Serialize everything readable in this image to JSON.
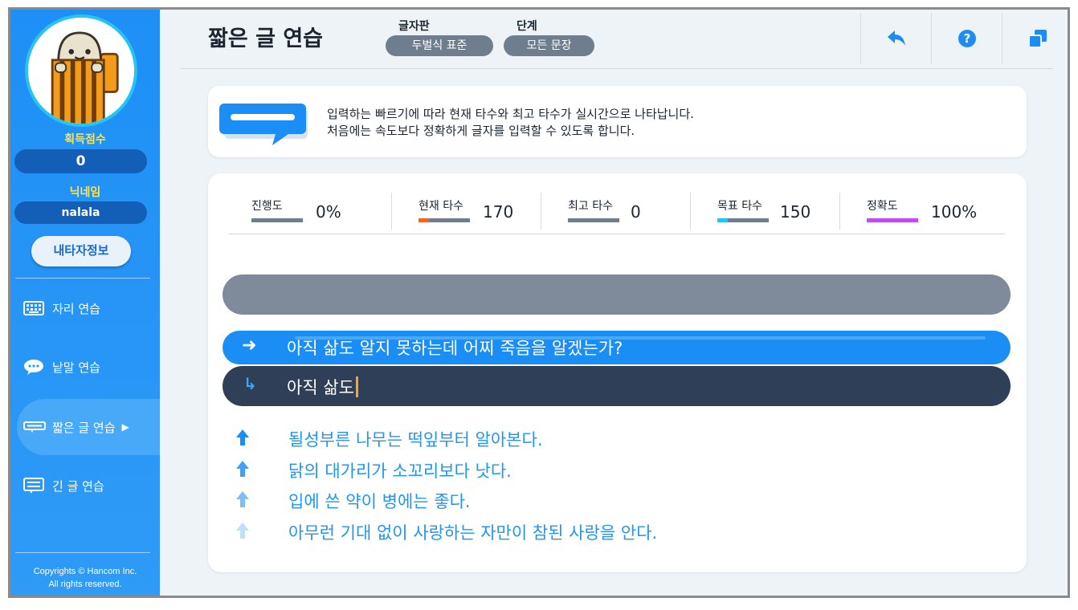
{
  "sidebar": {
    "score_label": "획득점수",
    "score_value": "0",
    "nickname_label": "닉네임",
    "nickname_value": "nalala",
    "my_info_button": "내타자정보",
    "menu": [
      {
        "label": "자리 연습",
        "icon": "keyboard-icon",
        "active": false
      },
      {
        "label": "낱말 연습",
        "icon": "speech-bubble-icon",
        "active": false
      },
      {
        "label": "짧은 글 연습",
        "icon": "short-text-icon",
        "active": true
      },
      {
        "label": "긴 글 연습",
        "icon": "long-text-icon",
        "active": false
      }
    ],
    "copyright_line1": "Copyrights © Hancom Inc.",
    "copyright_line2": "All rights reserved."
  },
  "header": {
    "title": "짧은 글 연습",
    "keyboard_label": "글자판",
    "keyboard_value": "두벌식 표준",
    "level_label": "단계",
    "level_value": "모든 문장",
    "buttons": [
      "back-icon",
      "help-icon",
      "window-icon"
    ]
  },
  "banner": {
    "line1": "입력하는 빠르기에 따라 현재 타수와 최고 타수가 실시간으로 나타납니다.",
    "line2": "처음에는 속도보다 정확하게 글자를 입력할 수 있도록 합니다."
  },
  "stats": [
    {
      "label": "진행도",
      "value": "0%",
      "fill_fraction": 0.0,
      "fill_color": "#6f7e8f"
    },
    {
      "label": "현재 타수",
      "value": "170",
      "fill_fraction": 0.2,
      "fill_color": "#f26522"
    },
    {
      "label": "최고 타수",
      "value": "0",
      "fill_fraction": 0.0,
      "fill_color": "#6f7e8f"
    },
    {
      "label": "목표 타수",
      "value": "150",
      "fill_fraction": 0.2,
      "fill_color": "#27c4f0"
    },
    {
      "label": "정확도",
      "value": "100%",
      "fill_fraction": 1.0,
      "fill_color": "#c04cf0"
    }
  ],
  "practice": {
    "target_sentence": "아직 삶도 알지 못하는데 어찌 죽음을 알겠는가?",
    "typed_text": "아직 삶도",
    "upcoming": [
      "될성부른 나무는 떡잎부터 알아본다.",
      "닭의 대가리가 소꼬리보다 낫다.",
      "입에 쓴 약이 병에는 좋다.",
      "아무런 기대 없이 사랑하는 자만이 참된 사랑을 안다."
    ]
  },
  "colors": {
    "sidebar_blue": "#1d8ff6",
    "accent_yellow": "#ffe34a",
    "target_blue": "#1b8ef5",
    "input_navy": "#2f3f57",
    "upcoming_text": "#2196ee",
    "caret": "#f5a623"
  }
}
